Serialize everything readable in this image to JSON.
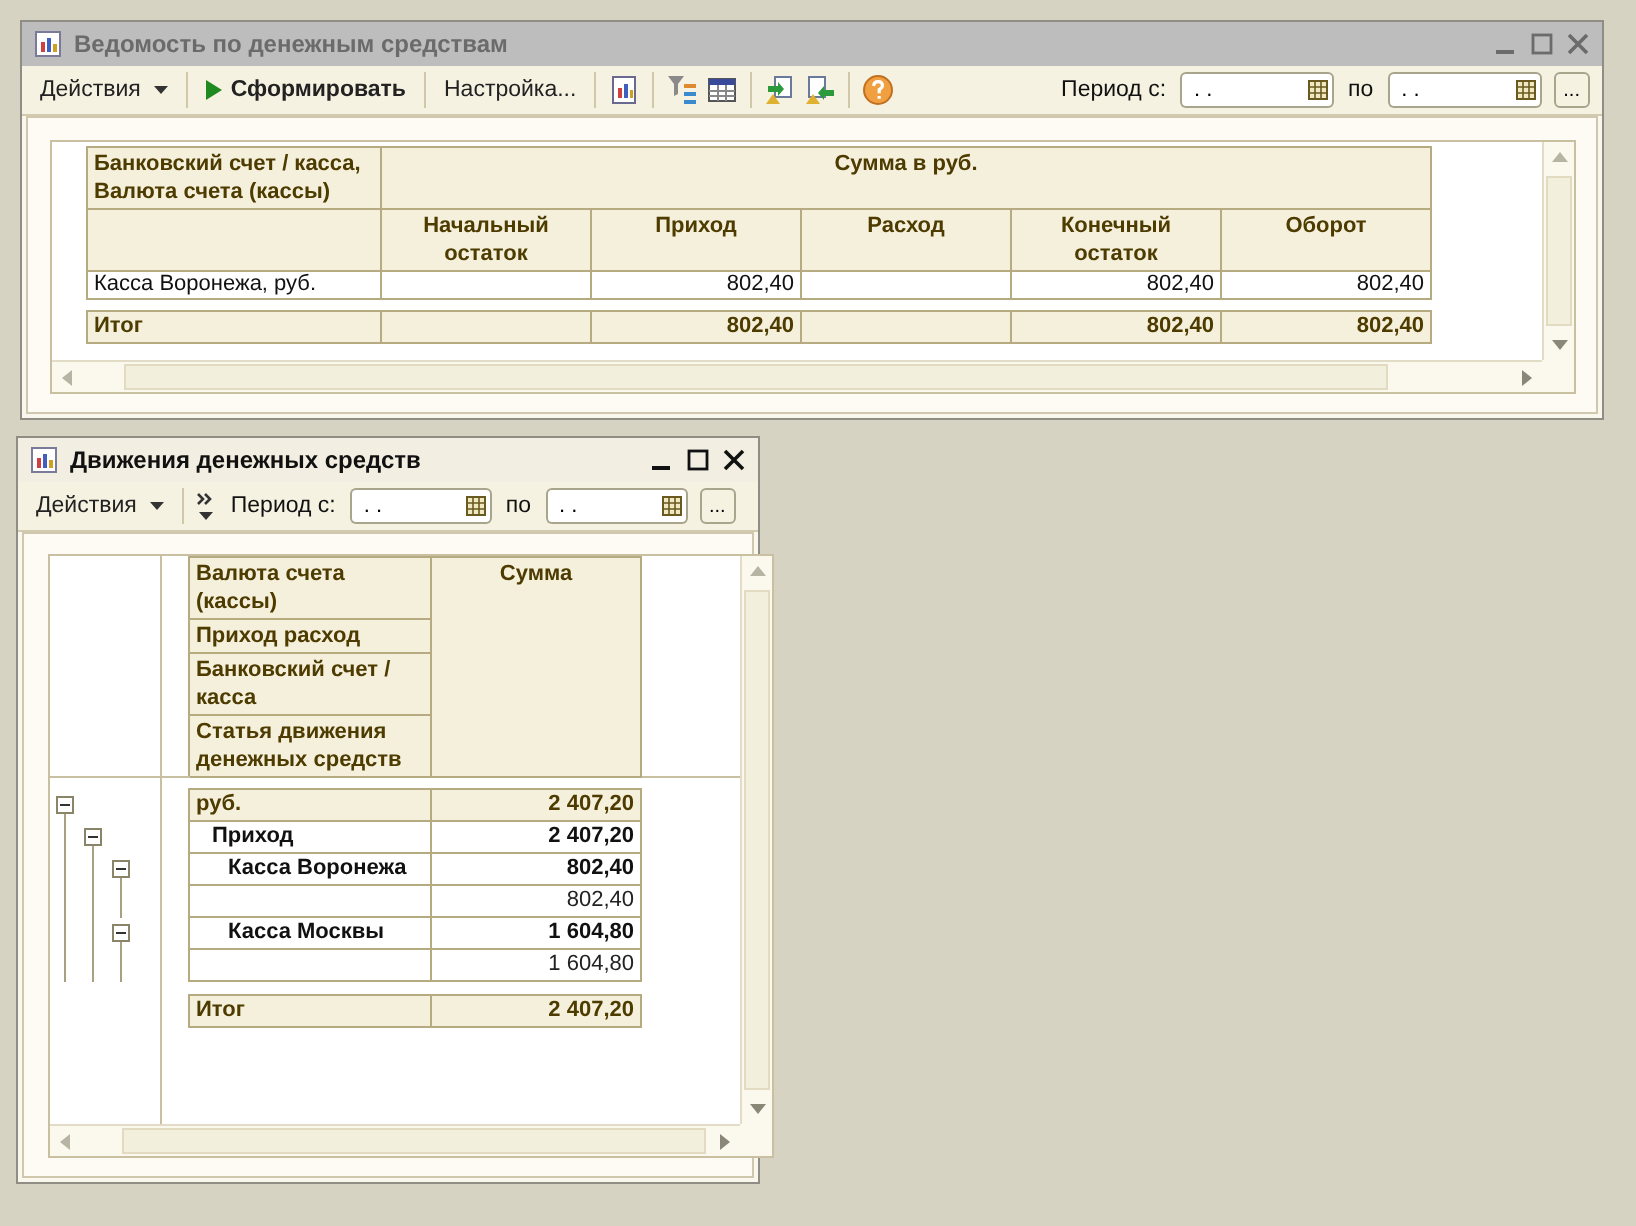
{
  "report_window": {
    "title": "Ведомость по денежным средствам",
    "active": false,
    "toolbar": {
      "actions": "Действия",
      "generate": "Сформировать",
      "settings": "Настройка...",
      "period_label": "Период с:",
      "from_value": ". .",
      "to_label": "по",
      "to_value": ". .",
      "more": "..."
    },
    "table": {
      "row_header": "Банковский счет / касса, Валюта счета (кассы)",
      "group_header": "Сумма в руб.",
      "columns": [
        "Начальный остаток",
        "Приход",
        "Расход",
        "Конечный остаток",
        "Оборот"
      ],
      "rows": [
        {
          "label": "Касса Воронежа, руб.",
          "income": "802,40",
          "closing_balance": "802,40",
          "turnover": "802,40"
        }
      ],
      "total": {
        "label": "Итог",
        "income": "802,40",
        "closing_balance": "802,40",
        "turnover": "802,40"
      }
    }
  },
  "movements_window": {
    "title": "Движения денежных средств",
    "active": true,
    "toolbar": {
      "actions": "Действия",
      "period_label": "Период с:",
      "from_value": ". .",
      "to_label": "по",
      "to_value": ". .",
      "more": "..."
    },
    "header_rows": [
      "Валюта счета (кассы)",
      "Приход расход",
      "Банковский счет / касса",
      "Статья движения денежных средств"
    ],
    "value_header": "Сумма",
    "tree": [
      {
        "kind": "currency",
        "label": "руб.",
        "value": "2 407,20",
        "expanded": true,
        "children": [
          {
            "kind": "group",
            "label": "Приход",
            "value": "2 407,20",
            "expanded": true,
            "children": [
              {
                "kind": "group",
                "label": "Касса Воронежа",
                "value": "802,40",
                "expanded": true,
                "children": [
                  {
                    "kind": "detail",
                    "value": "802,40"
                  }
                ]
              },
              {
                "kind": "group",
                "label": "Касса Москвы",
                "value": "1 604,80",
                "expanded": true,
                "children": [
                  {
                    "kind": "detail",
                    "value": "1 604,80"
                  }
                ]
              }
            ]
          }
        ]
      }
    ],
    "total": {
      "label": "Итог",
      "value": "2 407,20"
    }
  }
}
